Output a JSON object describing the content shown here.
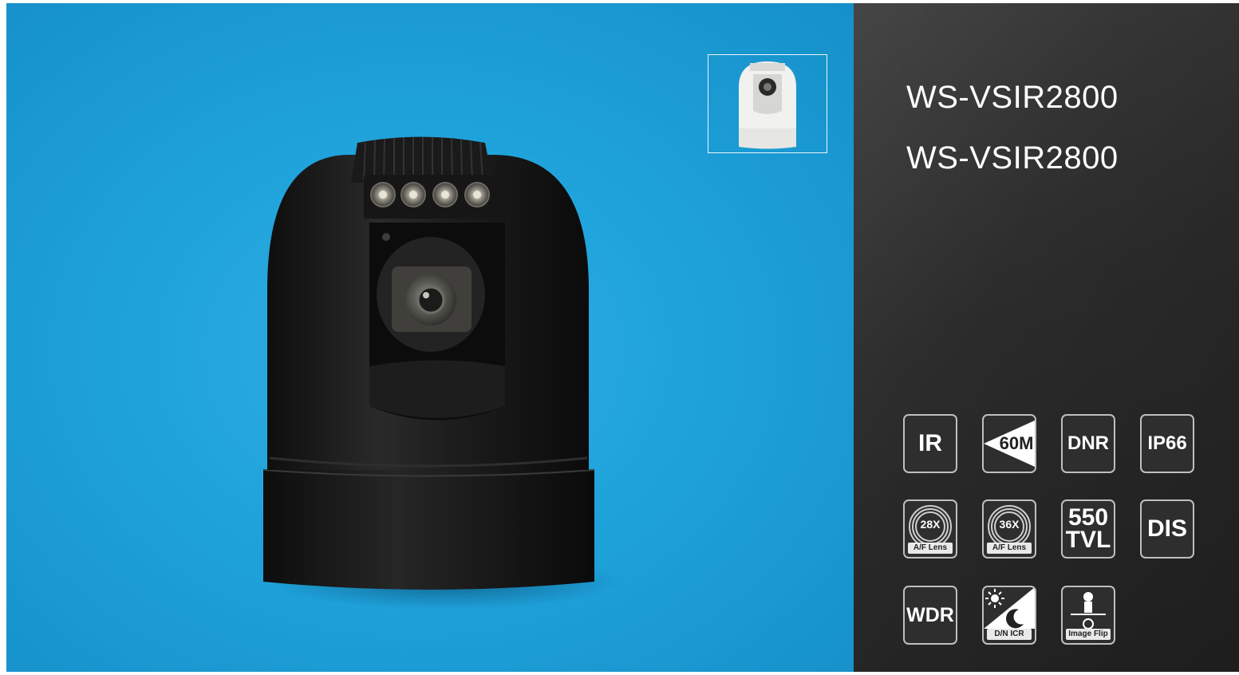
{
  "product": {
    "model_line_1": "WS-VSIR2800",
    "model_line_2": "WS-VSIR2800"
  },
  "colors": {
    "stage_blue": "#1fa2da",
    "panel_dark": "#2b2b2b",
    "badge_border": "#bfbfbf"
  },
  "badges": {
    "ir": "IR",
    "range": "60M",
    "dnr": "DNR",
    "ip66": "IP66",
    "lens28_zoom": "28X",
    "lens28_caption": "A/F Lens",
    "lens36_zoom": "36X",
    "lens36_caption": "A/F Lens",
    "tvl_value": "550",
    "tvl_unit": "TVL",
    "dis": "DIS",
    "wdr": "WDR",
    "dnicr_caption": "D/N ICR",
    "flip_caption": "Image Flip"
  },
  "icons": {
    "thumbnail": "camera-thumbnail-icon",
    "range": "ir-beam-icon",
    "lens": "zoom-lens-icon",
    "day_night": "sun-moon-icon",
    "flip": "image-flip-icon"
  }
}
